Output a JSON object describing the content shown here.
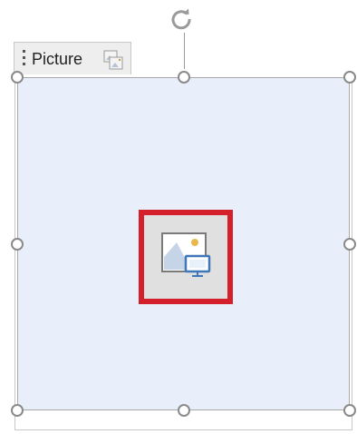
{
  "control": {
    "tag_label": "Picture"
  },
  "icons": {
    "rotate": "rotate-icon",
    "grip": "drag-grip-icon",
    "tab_picture": "picture-options-icon",
    "insert_picture": "insert-picture-icon"
  },
  "colors": {
    "placeholder_fill": "#e8eefa",
    "highlight_border": "#d4202a",
    "handle_border": "#8a8a8a"
  }
}
